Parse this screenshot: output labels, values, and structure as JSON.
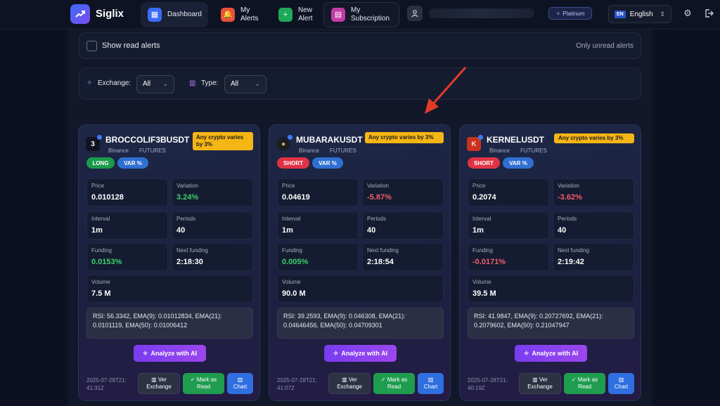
{
  "header": {
    "brand": "Siglix",
    "nav": {
      "dashboard": "Dashboard",
      "my_alerts": "My\nAlerts",
      "new_alert": "New\nAlert",
      "my_subscription": "My\nSubscription"
    },
    "plan_badge": "Platinum",
    "language": {
      "code": "EN",
      "label": "English"
    }
  },
  "filters": {
    "show_read_label": "Show read alerts",
    "only_unread_label": "Only unread alerts",
    "exchange_label": "Exchange:",
    "exchange_value": "All",
    "type_label": "Type:",
    "type_value": "All"
  },
  "cards": [
    {
      "icon_text": "3",
      "symbol": "BROCCOLIF3BUSDT",
      "exchange": "Binance",
      "market": "FUTURES",
      "condition": "Any crypto varies by 3%",
      "direction": "LONG",
      "type": "VAR %",
      "price_label": "Price",
      "price": "0.010128",
      "variation_label": "Variation",
      "variation": "3.24%",
      "interval_label": "Interval",
      "interval": "1m",
      "periods_label": "Periods",
      "periods": "40",
      "funding_label": "Funding",
      "funding": "0.0153%",
      "next_funding_label": "Next funding",
      "next_funding": "2:18:30",
      "volume_label": "Volume",
      "volume": "7.5 M",
      "indicators": "RSI: 56.3342, EMA(9): 0.01012834, EMA(21): 0.0101119, EMA(50): 0.01006412",
      "ai_button": "Analyze with AI",
      "timestamp": "2025-07-28T21:41:31Z",
      "btn_exchange_1": "Ver",
      "btn_exchange_2": "Exchange",
      "btn_read_1": "Mark as",
      "btn_read_2": "Read",
      "btn_chart": "Chart"
    },
    {
      "icon_text": "●",
      "symbol": "MUBARAKUSDT",
      "exchange": "Binance",
      "market": "FUTURES",
      "condition": "Any crypto varies by 3%",
      "direction": "SHORT",
      "type": "VAR %",
      "price_label": "Price",
      "price": "0.04619",
      "variation_label": "Variation",
      "variation": "-5.87%",
      "interval_label": "Interval",
      "interval": "1m",
      "periods_label": "Periods",
      "periods": "40",
      "funding_label": "Funding",
      "funding": "0.005%",
      "next_funding_label": "Next funding",
      "next_funding": "2:18:54",
      "volume_label": "Volume",
      "volume": "90.0 M",
      "indicators": "RSI: 39.2593, EMA(9): 0.046308, EMA(21): 0.04646456, EMA(50): 0.04709301",
      "ai_button": "Analyze with AI",
      "timestamp": "2025-07-28T21:41:07Z",
      "btn_exchange_1": "Ver",
      "btn_exchange_2": "Exchange",
      "btn_read_1": "Mark as",
      "btn_read_2": "Read",
      "btn_chart": "Chart"
    },
    {
      "icon_text": "K",
      "symbol": "KERNELUSDT",
      "exchange": "Binance",
      "market": "FUTURES",
      "condition": "Any crypto varies by 3%",
      "direction": "SHORT",
      "type": "VAR %",
      "price_label": "Price",
      "price": "0.2074",
      "variation_label": "Variation",
      "variation": "-3.62%",
      "interval_label": "Interval",
      "interval": "1m",
      "periods_label": "Periods",
      "periods": "40",
      "funding_label": "Funding",
      "funding": "-0.0171%",
      "next_funding_label": "Next funding",
      "next_funding": "2:19:42",
      "volume_label": "Volume",
      "volume": "39.5 M",
      "indicators": "RSI: 41.9847, EMA(9): 0.20727692, EMA(21): 0.2079602, EMA(50): 0.21047947",
      "ai_button": "Analyze with AI",
      "timestamp": "2025-07-28T21:40:19Z",
      "btn_exchange_1": "Ver",
      "btn_exchange_2": "Exchange",
      "btn_read_1": "Mark as",
      "btn_read_2": "Read",
      "btn_chart": "Chart"
    }
  ],
  "colors": {
    "accent": "#3b6cf6",
    "ai": "#8b44ef",
    "positive": "#3bd16b",
    "negative": "#f05e6a",
    "condition_badge": "#f5b514"
  },
  "icons": [
    "chart-up-logo-icon",
    "grid-icon",
    "bell-icon",
    "plus-icon",
    "receipt-icon",
    "user-icon",
    "sparkle-icon",
    "gear-icon",
    "logout-icon",
    "bar-chart-icon",
    "check-icon",
    "chevron-down-icon"
  ]
}
